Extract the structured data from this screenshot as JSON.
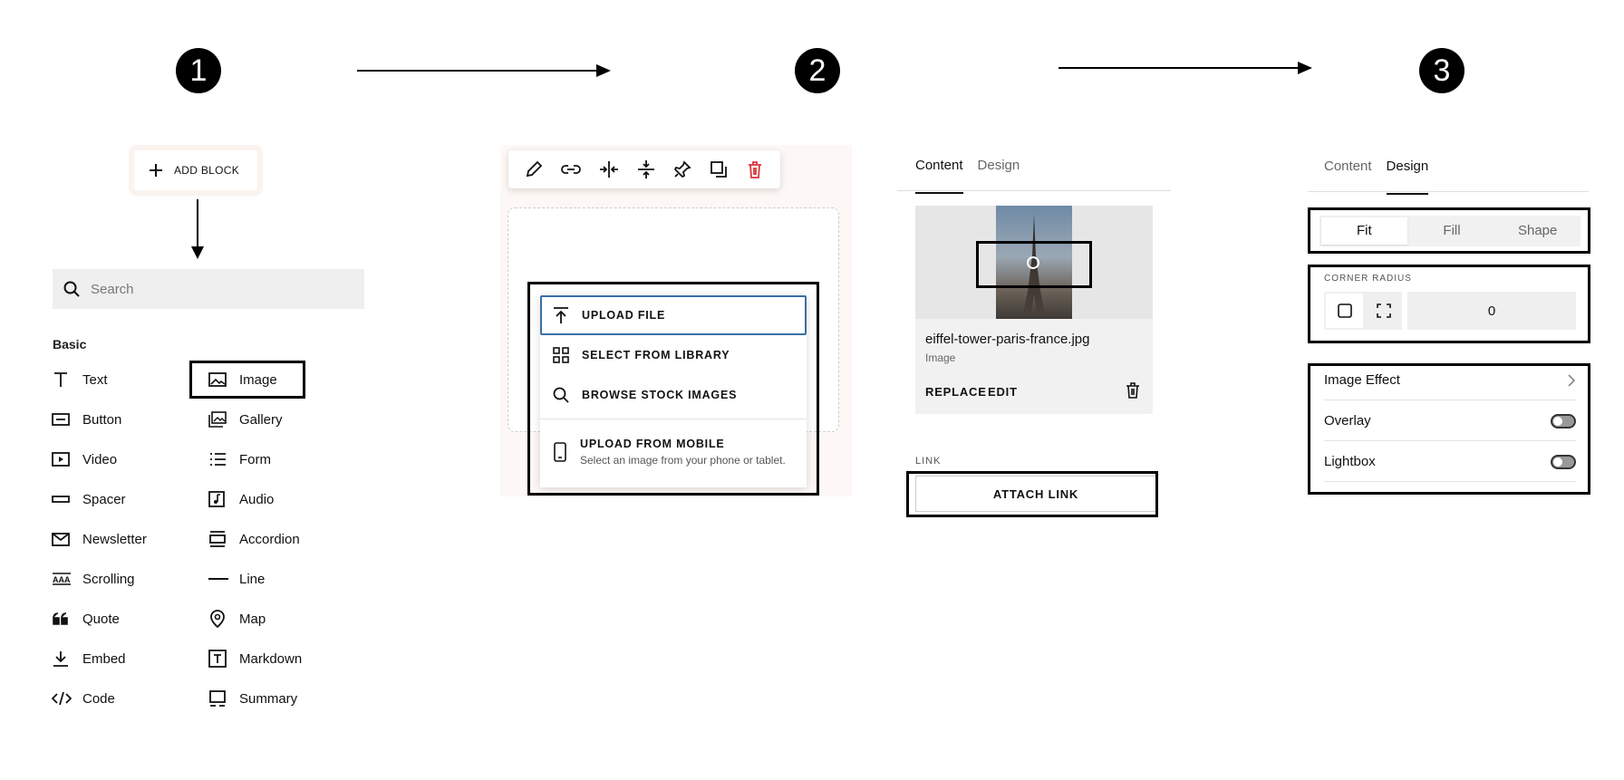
{
  "steps": [
    "1",
    "2",
    "3"
  ],
  "add_block": {
    "label": "ADD BLOCK"
  },
  "search": {
    "placeholder": "Search"
  },
  "section_title": "Basic",
  "blocks_col1": [
    {
      "label": "Text",
      "icon": "text-icon"
    },
    {
      "label": "Button",
      "icon": "button-icon"
    },
    {
      "label": "Video",
      "icon": "video-icon"
    },
    {
      "label": "Spacer",
      "icon": "spacer-icon"
    },
    {
      "label": "Newsletter",
      "icon": "newsletter-icon"
    },
    {
      "label": "Scrolling",
      "icon": "scrolling-icon"
    },
    {
      "label": "Quote",
      "icon": "quote-icon"
    },
    {
      "label": "Embed",
      "icon": "embed-icon"
    },
    {
      "label": "Code",
      "icon": "code-icon"
    }
  ],
  "blocks_col2": [
    {
      "label": "Image",
      "icon": "image-icon"
    },
    {
      "label": "Gallery",
      "icon": "gallery-icon"
    },
    {
      "label": "Form",
      "icon": "form-icon"
    },
    {
      "label": "Audio",
      "icon": "audio-icon"
    },
    {
      "label": "Accordion",
      "icon": "accordion-icon"
    },
    {
      "label": "Line",
      "icon": "line-icon"
    },
    {
      "label": "Map",
      "icon": "map-icon"
    },
    {
      "label": "Markdown",
      "icon": "markdown-icon"
    },
    {
      "label": "Summary",
      "icon": "summary-icon"
    }
  ],
  "toolbar_icons": [
    "pencil-icon",
    "link-icon",
    "align-horizontal-icon",
    "align-vertical-icon",
    "pin-icon",
    "duplicate-icon",
    "trash-icon"
  ],
  "upload_menu": {
    "upload_file": "UPLOAD FILE",
    "select_library": "SELECT FROM LIBRARY",
    "browse_stock": "BROWSE STOCK IMAGES",
    "upload_mobile": "UPLOAD FROM MOBILE",
    "upload_mobile_sub": "Select an image from your phone or tablet."
  },
  "content_panel": {
    "tab_content": "Content",
    "tab_design": "Design",
    "file_name": "eiffel-tower-paris-france.jpg",
    "file_type": "Image",
    "replace": "REPLACE",
    "edit": "EDIT",
    "link_label": "LINK",
    "attach_link": "ATTACH LINK"
  },
  "design_panel": {
    "tab_content": "Content",
    "tab_design": "Design",
    "fit": "Fit",
    "fill": "Fill",
    "shape": "Shape",
    "corner_radius_label": "CORNER RADIUS",
    "corner_radius_value": "0",
    "image_effect": "Image Effect",
    "overlay": "Overlay",
    "lightbox": "Lightbox",
    "overlay_on": false,
    "lightbox_on": false
  },
  "colors": {
    "accent_red": "#d9363e",
    "focus_blue": "#3a6ea5"
  }
}
